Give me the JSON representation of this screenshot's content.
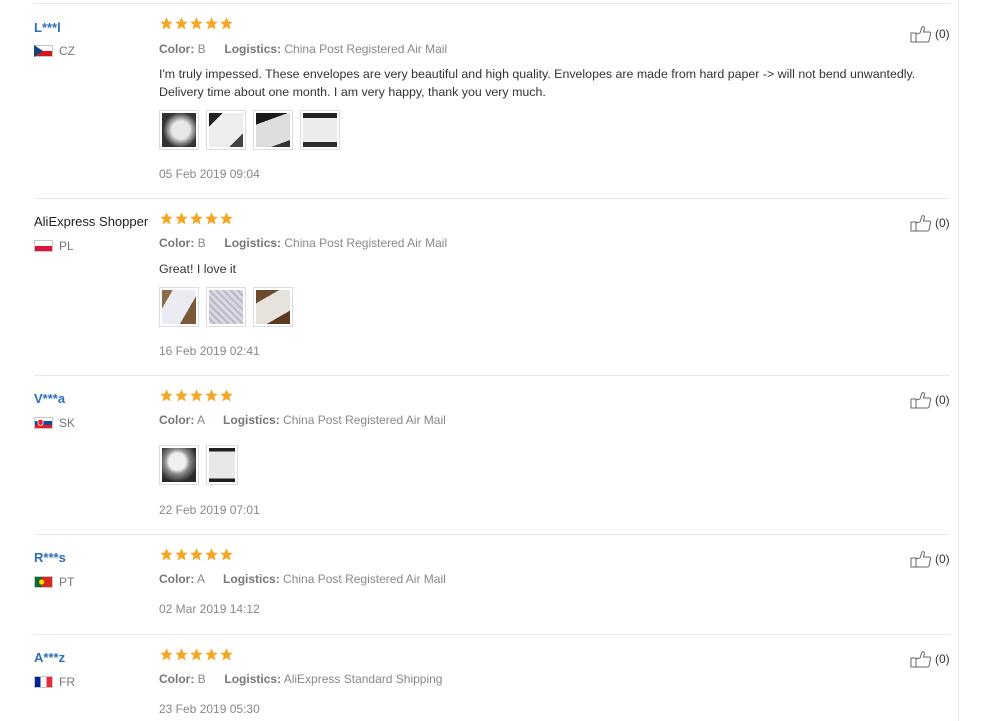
{
  "reviews": [
    {
      "name": "L***l",
      "country": "CZ",
      "rating": 5,
      "color_label": "Color:",
      "color_value": "B",
      "logistics_label": "Logistics:",
      "logistics_value": "China Post Registered Air Mail",
      "content": "I'm truly impessed. These envelopes are very beautiful and high quality. Envelopes are made from hard paper -> will not bend unwantedly. Delivery time about one month. I am very happy, thank you very much.",
      "date": "05 Feb 2019 09:04",
      "helpful": "(0)"
    },
    {
      "name": "AliExpress Shopper",
      "country": "PL",
      "rating": 5,
      "color_label": "Color:",
      "color_value": "B",
      "logistics_label": "Logistics:",
      "logistics_value": "China Post Registered Air Mail",
      "content": "Great! I love it",
      "date": "16 Feb 2019 02:41",
      "helpful": "(0)"
    },
    {
      "name": "V***a",
      "country": "SK",
      "rating": 5,
      "color_label": "Color:",
      "color_value": "A",
      "logistics_label": "Logistics:",
      "logistics_value": "China Post Registered Air Mail",
      "date": "22 Feb 2019 07:01",
      "helpful": "(0)"
    },
    {
      "name": "R***s",
      "country": "PT",
      "rating": 5,
      "color_label": "Color:",
      "color_value": "A",
      "logistics_label": "Logistics:",
      "logistics_value": "China Post Registered Air Mail",
      "date": "02 Mar 2019 14:12",
      "helpful": "(0)"
    },
    {
      "name": "A***z",
      "country": "FR",
      "rating": 5,
      "color_label": "Color:",
      "color_value": "B",
      "logistics_label": "Logistics:",
      "logistics_value": "AliExpress Standard Shipping",
      "date": "23 Feb 2019 05:30",
      "helpful": "(0)"
    }
  ],
  "icons": {
    "star": "star-icon",
    "thumbs_up": "thumbs-up-icon"
  },
  "colors": {
    "star": "#f5a623",
    "name_link": "#2a6ebb",
    "muted_text": "#888888"
  }
}
